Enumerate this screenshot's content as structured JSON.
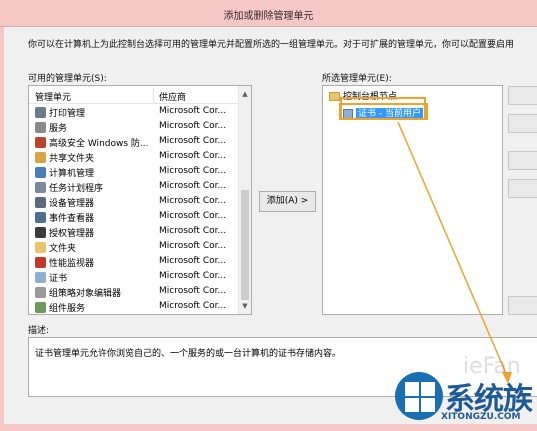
{
  "window": {
    "title": "添加或删除管理单元"
  },
  "intro": "你可以在计算机上为此控制台选择可用的管理单元并配置所选的一组管理单元。对于可扩展的管理单元，你可以配置要启用",
  "available": {
    "label": "可用的管理单元(S):",
    "col_name": "管理单元",
    "col_vendor": "供应商",
    "items": [
      {
        "name": "打印管理",
        "vendor": "Microsoft Cor...",
        "icon": "printer-icon",
        "color": "#6b7b8c"
      },
      {
        "name": "服务",
        "vendor": "Microsoft Cor...",
        "icon": "gear-icon",
        "color": "#8a8a8a"
      },
      {
        "name": "高级安全 Windows 防...",
        "vendor": "Microsoft Cor...",
        "icon": "firewall-icon",
        "color": "#b7472a"
      },
      {
        "name": "共享文件夹",
        "vendor": "Microsoft Cor...",
        "icon": "shared-folder-icon",
        "color": "#d9a441"
      },
      {
        "name": "计算机管理",
        "vendor": "Microsoft Cor...",
        "icon": "computer-icon",
        "color": "#4a7db5"
      },
      {
        "name": "任务计划程序",
        "vendor": "Microsoft Cor...",
        "icon": "clock-icon",
        "color": "#7a8a9a"
      },
      {
        "name": "设备管理器",
        "vendor": "Microsoft Cor...",
        "icon": "device-icon",
        "color": "#5b6b7b"
      },
      {
        "name": "事件查看器",
        "vendor": "Microsoft Cor...",
        "icon": "event-icon",
        "color": "#4f6f8f"
      },
      {
        "name": "授权管理器",
        "vendor": "Microsoft Cor...",
        "icon": "authorization-icon",
        "color": "#3b3b3b"
      },
      {
        "name": "文件夹",
        "vendor": "Microsoft Cor...",
        "icon": "folder-icon",
        "color": "#e9c46a"
      },
      {
        "name": "性能监视器",
        "vendor": "Microsoft Cor...",
        "icon": "performance-icon",
        "color": "#c0392b"
      },
      {
        "name": "证书",
        "vendor": "Microsoft Cor...",
        "icon": "certificate-icon",
        "color": "#8fb0d0"
      },
      {
        "name": "组策略对象编辑器",
        "vendor": "Microsoft Cor...",
        "icon": "policy-icon",
        "color": "#9a9a9a"
      },
      {
        "name": "组件服务",
        "vendor": "Microsoft Cor...",
        "icon": "component-icon",
        "color": "#6a9a5a"
      }
    ]
  },
  "add_button": "添加(A) >",
  "selected": {
    "label": "所选管理单元(E):",
    "root": "控制台根节点",
    "child": "证书 - 当前用户"
  },
  "description": {
    "label": "描述:",
    "text": "证书管理单元允许你浏览自己的、一个服务的或一台计算机的证书存储内容。"
  },
  "watermark": {
    "brand": "系统族",
    "url": "XITONGZU.COM",
    "faint": "ieFan"
  },
  "colors": {
    "titlebar": "#f6c7c7",
    "selection": "#3399ff",
    "highlight_box": "#f0a22e"
  }
}
